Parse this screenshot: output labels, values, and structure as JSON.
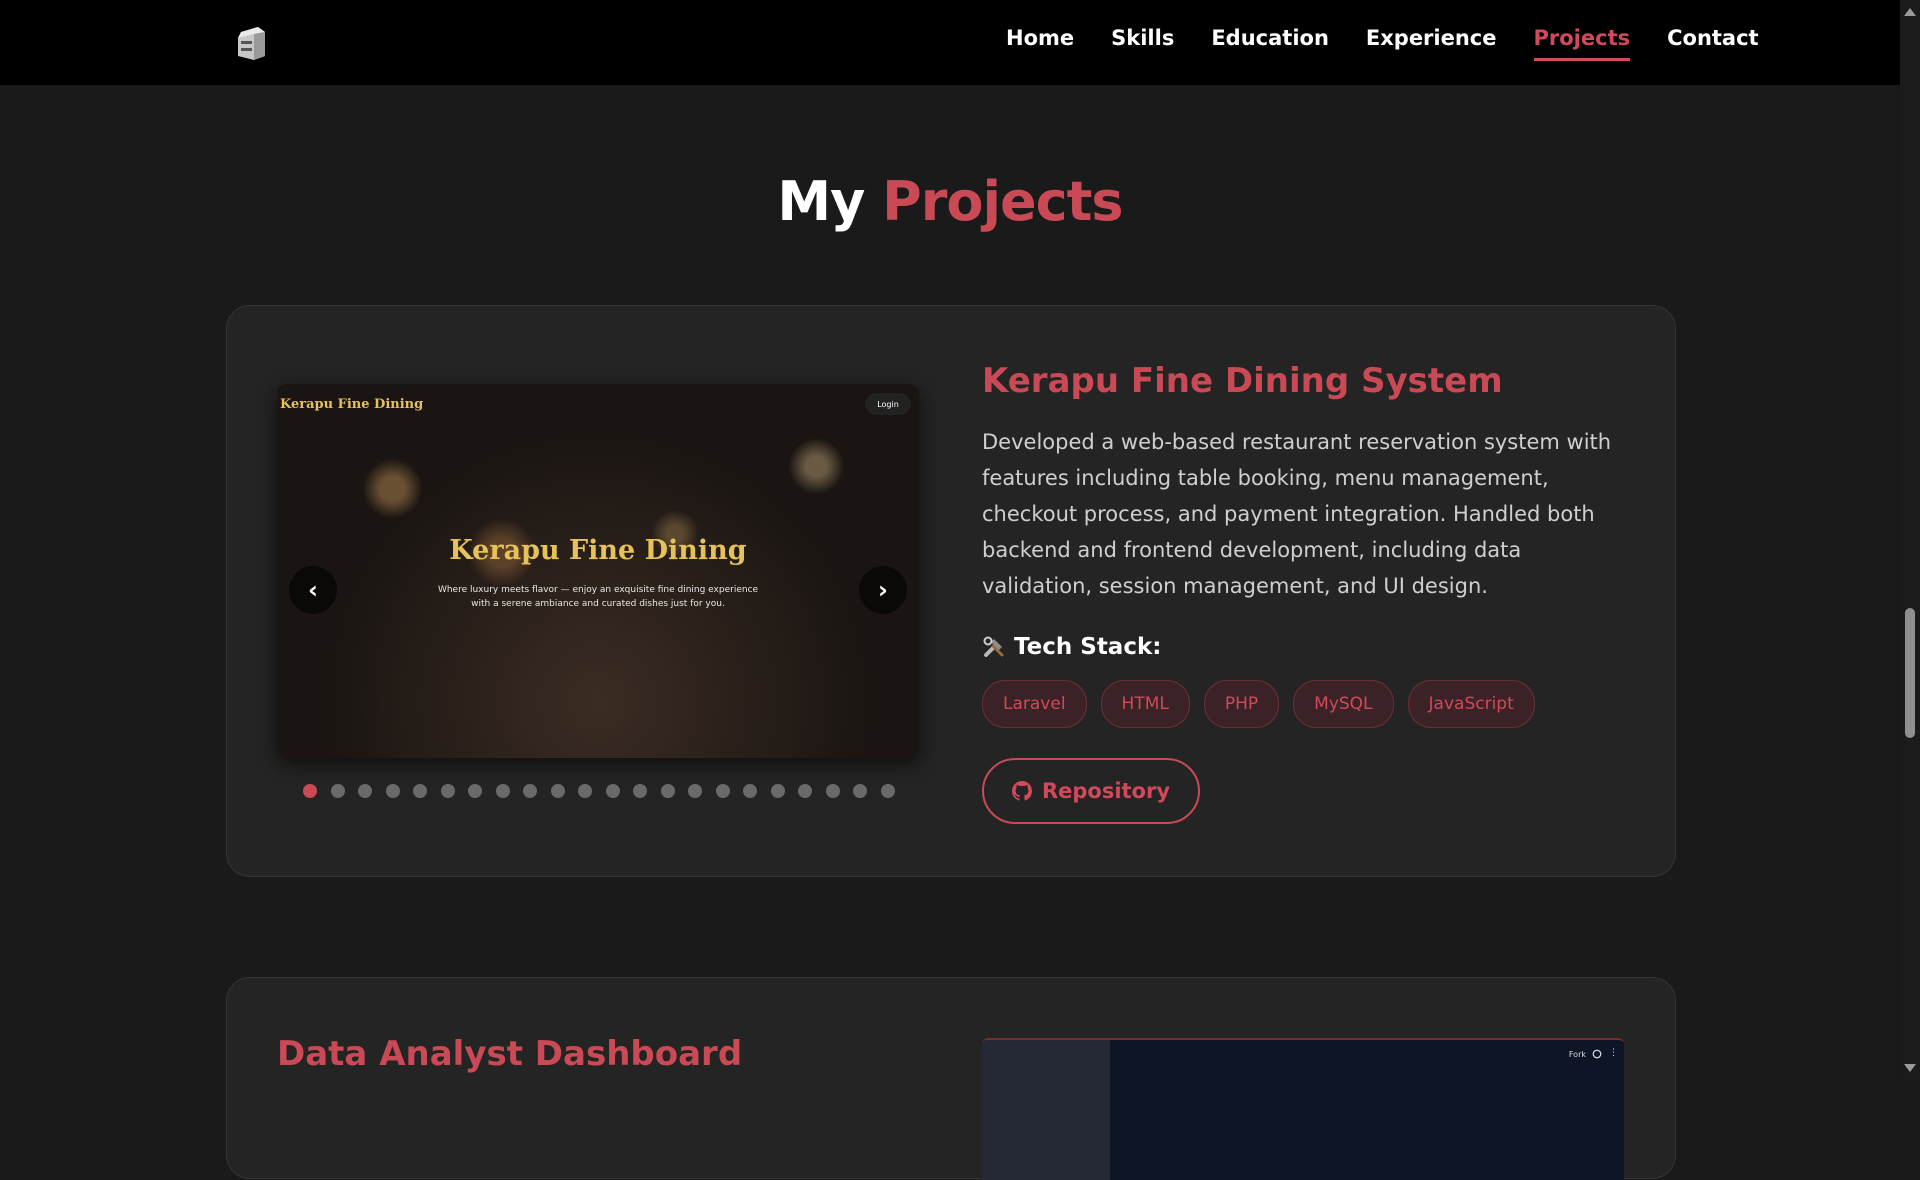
{
  "nav": {
    "items": [
      {
        "label": "Home"
      },
      {
        "label": "Skills"
      },
      {
        "label": "Education"
      },
      {
        "label": "Experience"
      },
      {
        "label": "Projects",
        "active": true
      },
      {
        "label": "Contact"
      }
    ]
  },
  "heading": {
    "prefix": "My",
    "accent": "Projects"
  },
  "project1": {
    "title": "Kerapu Fine Dining System",
    "description": "Developed a web-based restaurant reservation system with features including table booking, menu management, checkout process, and payment integration. Handled both backend and frontend development, including data validation, session management, and UI design.",
    "tech_heading": "Tech Stack:",
    "tags": [
      "Laravel",
      "HTML",
      "PHP",
      "MySQL",
      "JavaScript"
    ],
    "repo_label": "Repository",
    "slide": {
      "brand": "Kerapu Fine Dining",
      "login": "Login",
      "heading": "Kerapu Fine Dining",
      "sub": "Where luxury meets flavor — enjoy an exquisite fine dining experience with a serene ambiance and curated dishes just for you."
    },
    "slide_count": 22,
    "active_slide": 1
  },
  "project2": {
    "title": "Data Analyst Dashboard",
    "preview_fork": "Fork"
  },
  "colors": {
    "accent": "#c94a55",
    "background": "#1a1a1a",
    "card": "#242424"
  },
  "icons": [
    "logo-icon",
    "tools-icon",
    "github-icon",
    "chevron-left-icon",
    "chevron-right-icon"
  ]
}
